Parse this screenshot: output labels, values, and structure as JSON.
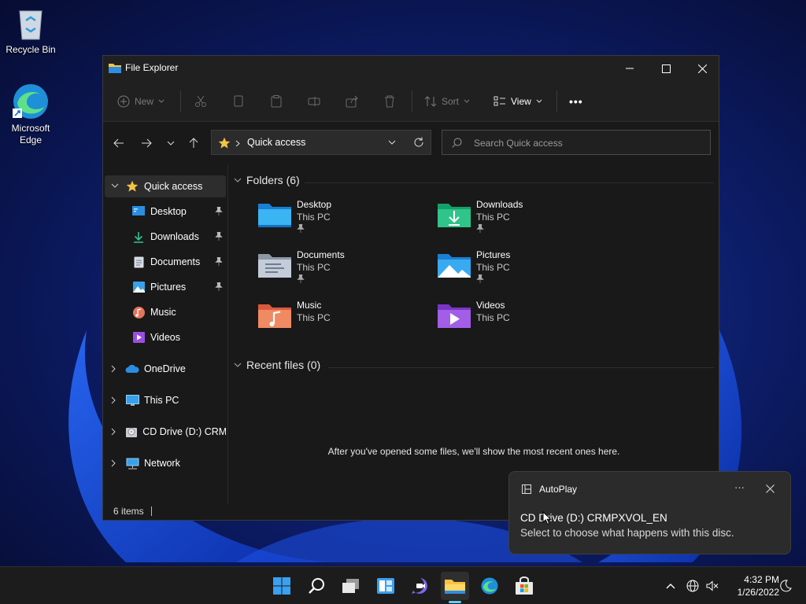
{
  "desktop": {
    "icons": [
      {
        "label": "Recycle Bin"
      },
      {
        "label": "Microsoft Edge"
      }
    ]
  },
  "window": {
    "title": "File Explorer",
    "toolbar": {
      "new_label": "New",
      "sort_label": "Sort",
      "view_label": "View",
      "more_label": "•••"
    },
    "address": {
      "path": "Quick access"
    },
    "search": {
      "placeholder": "Search Quick access"
    },
    "sidebar": {
      "items": [
        {
          "label": "Quick access"
        },
        {
          "label": "Desktop"
        },
        {
          "label": "Downloads"
        },
        {
          "label": "Documents"
        },
        {
          "label": "Pictures"
        },
        {
          "label": "Music"
        },
        {
          "label": "Videos"
        },
        {
          "label": "OneDrive"
        },
        {
          "label": "This PC"
        },
        {
          "label": "CD Drive (D:) CRMP."
        },
        {
          "label": "Network"
        }
      ]
    },
    "folders_header": "Folders (6)",
    "folders": [
      {
        "name": "Desktop",
        "location": "This PC"
      },
      {
        "name": "Downloads",
        "location": "This PC"
      },
      {
        "name": "Documents",
        "location": "This PC"
      },
      {
        "name": "Pictures",
        "location": "This PC"
      },
      {
        "name": "Music",
        "location": "This PC"
      },
      {
        "name": "Videos",
        "location": "This PC"
      }
    ],
    "recent_header": "Recent files (0)",
    "recent_message": "After you've opened some files, we'll show the most recent ones here.",
    "status": {
      "item_count": "6 items"
    }
  },
  "notification": {
    "app": "AutoPlay",
    "more": "···",
    "title": "CD Drive (D:) CRMPXVOL_EN",
    "body": "Select to choose what happens with this disc."
  },
  "taskbar": {
    "time": "4:32 PM",
    "date": "1/26/2022"
  },
  "colors": {
    "accent": "#60cdff",
    "folder_yellow": "#f4c443",
    "window_bg": "#191919"
  }
}
